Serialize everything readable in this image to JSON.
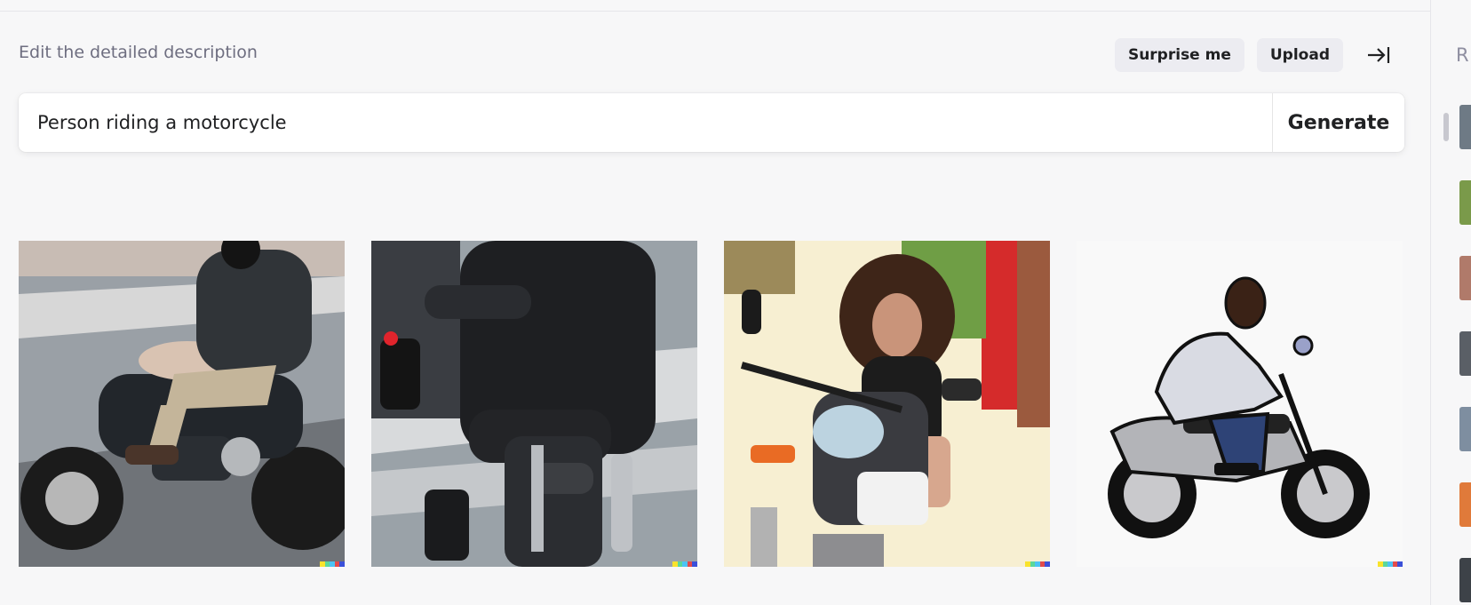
{
  "header": {
    "description_label": "Edit the detailed description",
    "surprise_label": "Surprise me",
    "upload_label": "Upload"
  },
  "prompt": {
    "value": "Person riding a motorcycle",
    "generate_label": "Generate"
  },
  "results": [
    {
      "label": "rider in leather jacket on cruiser motorcycle"
    },
    {
      "label": "rider from behind at crosswalk"
    },
    {
      "label": "woman sitting on motorcycle"
    },
    {
      "label": "cartoon man riding motorcycle"
    }
  ],
  "sidebar": {
    "label": "R"
  },
  "colors": {
    "accent": "#202123",
    "background": "#f7f7f8",
    "pill": "#ececf1"
  }
}
